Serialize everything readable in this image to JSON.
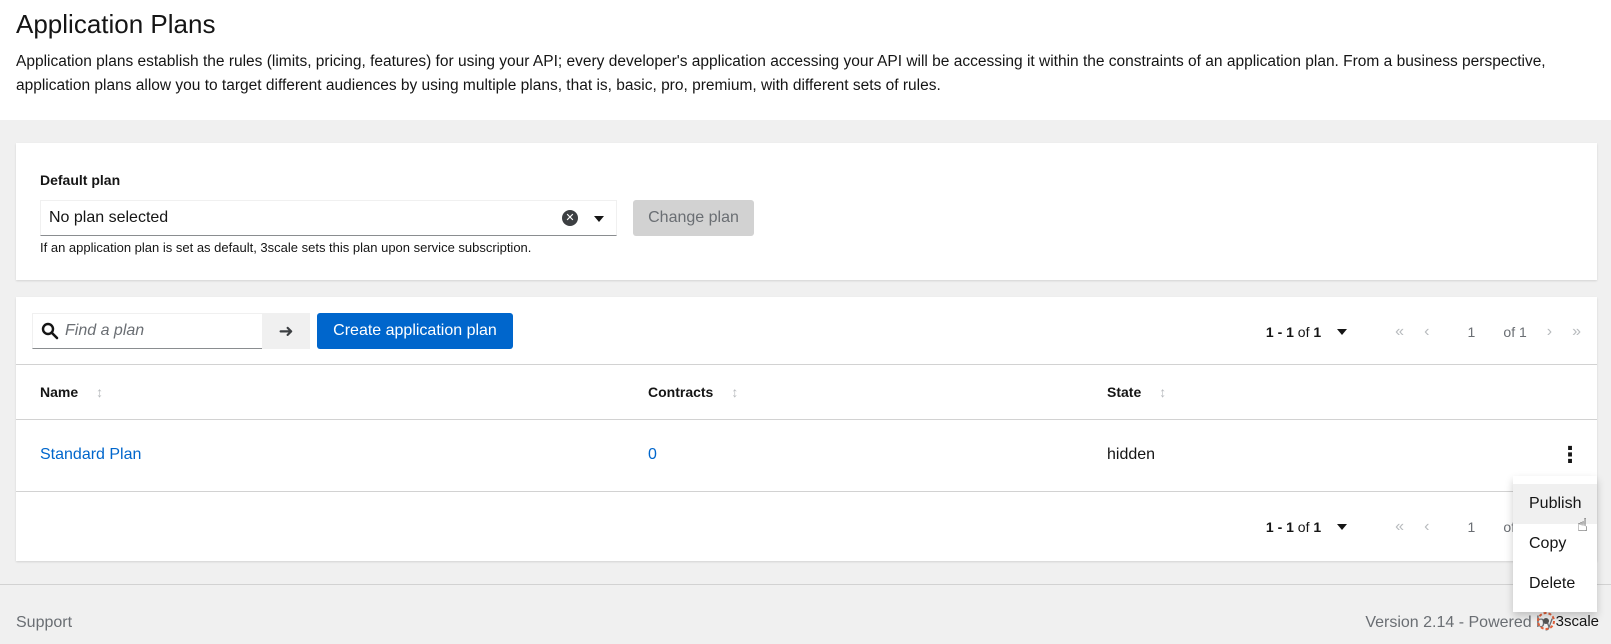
{
  "header": {
    "title": "Application Plans",
    "description": "Application plans establish the rules (limits, pricing, features) for using your API; every developer's application accessing your API will be accessing it within the constraints of an application plan. From a business perspective, application plans allow you to target different audiences by using multiple plans, that is, basic, pro, premium, with different sets of rules."
  },
  "default_plan": {
    "label": "Default plan",
    "selected": "No plan selected",
    "change_button": "Change plan",
    "helper": "If an application plan is set as default, 3scale sets this plan upon service subscription."
  },
  "toolbar": {
    "search_placeholder": "Find a plan",
    "create_button": "Create application plan"
  },
  "pagination": {
    "range": "1 - 1",
    "of_label": "of",
    "total": "1",
    "page": "1",
    "of_pages": "of 1"
  },
  "table": {
    "columns": [
      "Name",
      "Contracts",
      "State"
    ],
    "rows": [
      {
        "name": "Standard Plan",
        "contracts": "0",
        "state": "hidden"
      }
    ]
  },
  "menu": {
    "items": [
      "Publish",
      "Copy",
      "Delete"
    ]
  },
  "footer": {
    "support": "Support",
    "version": "Version 2.14 - Powered by",
    "brand": "3scale"
  },
  "colors": {
    "primary": "#0066cc",
    "link": "#0066cc",
    "disabled_bg": "#d2d2d2"
  }
}
